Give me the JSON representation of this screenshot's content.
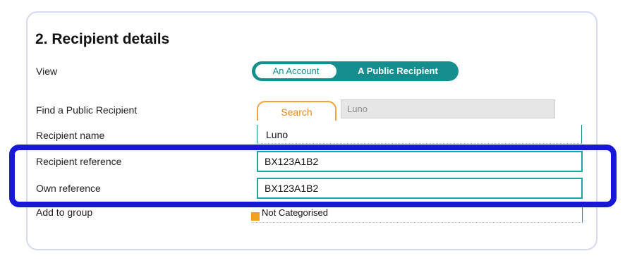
{
  "section": {
    "title": "2. Recipient details"
  },
  "rows": {
    "view_label": "View",
    "find_label": "Find a Public Recipient",
    "name_label": "Recipient name",
    "reference_label": "Recipient reference",
    "own_reference_label": "Own reference",
    "group_label": "Add to group"
  },
  "view_toggle": {
    "option_account": "An Account",
    "option_public": "A Public Recipient",
    "selected": "A Public Recipient"
  },
  "find": {
    "button_label": "Search",
    "field_value": "Luno"
  },
  "values": {
    "recipient_name": "Luno",
    "recipient_reference": "BX123A1B2",
    "own_reference": "BX123A1B2",
    "group": "Not Categorised"
  },
  "colors": {
    "accent": "#148f8e",
    "search_accent": "#f2a23a",
    "highlight": "#1818d8"
  },
  "icons": {
    "group": "folder-icon"
  }
}
